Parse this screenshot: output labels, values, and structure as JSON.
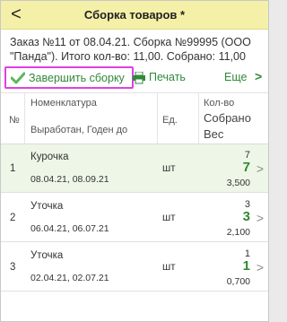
{
  "header": {
    "title": "Сборка товаров *",
    "back_glyph": "<"
  },
  "info": {
    "text": "Заказ №11 от 08.04.21. Сборка №99995 (ООО \"Панда\"). Итого кол-во: 11,00. Собрано: 11,00"
  },
  "toolbar": {
    "finish_label": "Завершить сборку",
    "print_label": "Печать",
    "more_label": "Еще",
    "more_chevron": ">"
  },
  "table": {
    "headers": {
      "num": "№",
      "nomenclature": "Номенклатура",
      "produced": "Выработан, Годен до",
      "unit": "Ед.",
      "qty": "Кол-во",
      "collected": "Собрано",
      "weight": "Вес"
    },
    "rows": [
      {
        "num": "1",
        "name": "Курочка",
        "dates": "08.04.21, 08.09.21",
        "unit": "шт",
        "plan": "7",
        "done": "7",
        "weight": "3,500",
        "chevron": ">"
      },
      {
        "num": "2",
        "name": "Уточка",
        "dates": "06.04.21, 06.07.21",
        "unit": "шт",
        "plan": "3",
        "done": "3",
        "weight": "2,100",
        "chevron": ">"
      },
      {
        "num": "3",
        "name": "Уточка",
        "dates": "02.04.21, 02.07.21",
        "unit": "шт",
        "plan": "1",
        "done": "1",
        "weight": "0,700",
        "chevron": ">"
      }
    ]
  },
  "colors": {
    "topbar_bg": "#f4f0a8",
    "accent_green": "#2f8a3a",
    "highlight_border": "#e040e0",
    "row_alt_bg": "#eef6e8"
  },
  "icons": {
    "back": "back-arrow-icon",
    "finish": "checkmark-icon",
    "print": "printer-icon",
    "more": "chevron-right-icon",
    "row": "chevron-right-icon"
  }
}
